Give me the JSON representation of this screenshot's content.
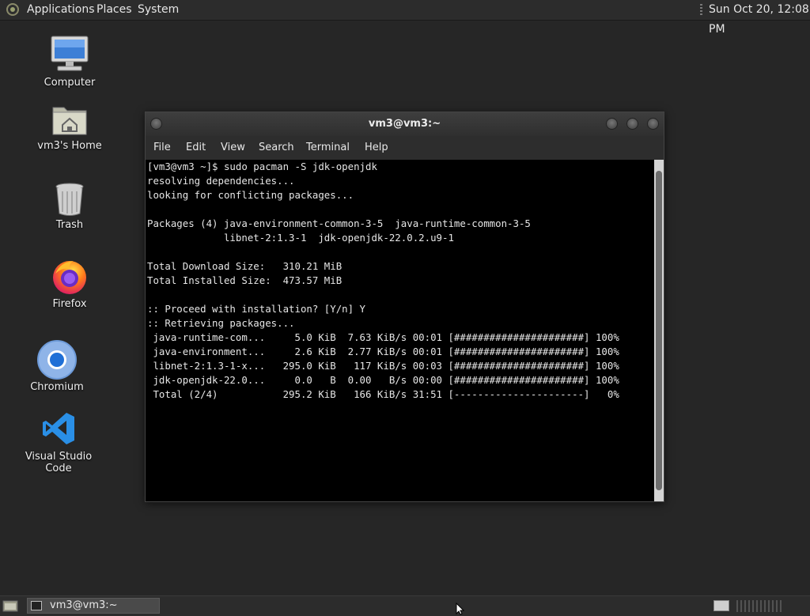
{
  "top_panel": {
    "menus": [
      "Applications",
      "Places",
      "System"
    ],
    "clock": "Sun Oct 20, 12:08 PM"
  },
  "desktop": {
    "icons": [
      {
        "label": "Computer",
        "icon": "computer-icon"
      },
      {
        "label": "vm3's Home",
        "icon": "home-folder-icon"
      },
      {
        "label": "Trash",
        "icon": "trash-icon"
      },
      {
        "label": "Firefox",
        "icon": "firefox-icon"
      },
      {
        "label": "Chromium",
        "icon": "chromium-icon"
      },
      {
        "label": "Visual Studio Code",
        "icon": "vscode-icon"
      }
    ]
  },
  "terminal": {
    "title": "vm3@vm3:~",
    "menu": [
      "File",
      "Edit",
      "View",
      "Search",
      "Terminal",
      "Help"
    ],
    "lines": [
      "[vm3@vm3 ~]$ sudo pacman -S jdk-openjdk",
      "resolving dependencies...",
      "looking for conflicting packages...",
      "",
      "Packages (4) java-environment-common-3-5  java-runtime-common-3-5",
      "             libnet-2:1.3-1  jdk-openjdk-22.0.2.u9-1",
      "",
      "Total Download Size:   310.21 MiB",
      "Total Installed Size:  473.57 MiB",
      "",
      ":: Proceed with installation? [Y/n] Y",
      ":: Retrieving packages...",
      " java-runtime-com...     5.0 KiB  7.63 KiB/s 00:01 [######################] 100%",
      " java-environment...     2.6 KiB  2.77 KiB/s 00:01 [######################] 100%",
      " libnet-2:1.3-1-x...   295.0 KiB   117 KiB/s 00:03 [######################] 100%",
      " jdk-openjdk-22.0...     0.0   B  0.00   B/s 00:00 [######################] 100%",
      " Total (2/4)           295.2 KiB   166 KiB/s 31:51 [----------------------]   0%"
    ]
  },
  "taskbar": {
    "task_label": "vm3@vm3:~"
  }
}
